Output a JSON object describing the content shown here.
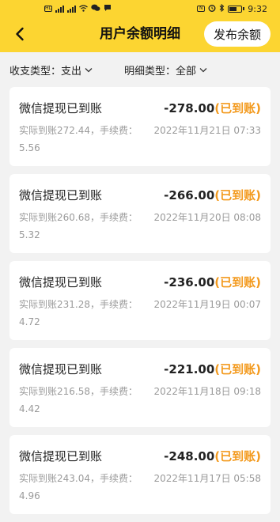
{
  "status_bar": {
    "time": "9:32",
    "left_indicators": [
      "HD",
      "4G",
      "4G",
      "wifi",
      "wechat",
      "message"
    ],
    "right_indicators": [
      "nfc",
      "alarm",
      "bluetooth",
      "battery"
    ]
  },
  "header": {
    "back_icon": "chevron-left-icon",
    "title": "用户余额明细",
    "publish_button": "发布余额",
    "background": "#fcd531"
  },
  "filters": {
    "income_expense": {
      "label": "收支类型：",
      "value": "支出"
    },
    "detail_type": {
      "label": "明细类型：",
      "value": "全部"
    }
  },
  "colors": {
    "status_accent": "#f39a1e",
    "muted_text": "#9a9a9a"
  },
  "records": [
    {
      "title": "微信提现已到账",
      "amount": "-278.00",
      "status": "(已到账)",
      "note": "实际到账272.44，手续费：5.56",
      "time": "2022年11月21日 07:33"
    },
    {
      "title": "微信提现已到账",
      "amount": "-266.00",
      "status": "(已到账)",
      "note": "实际到账260.68，手续费：5.32",
      "time": "2022年11月20日 08:08"
    },
    {
      "title": "微信提现已到账",
      "amount": "-236.00",
      "status": "(已到账)",
      "note": "实际到账231.28，手续费：4.72",
      "time": "2022年11月19日 00:07"
    },
    {
      "title": "微信提现已到账",
      "amount": "-221.00",
      "status": "(已到账)",
      "note": "实际到账216.58，手续费：4.42",
      "time": "2022年11月18日 09:18"
    },
    {
      "title": "微信提现已到账",
      "amount": "-248.00",
      "status": "(已到账)",
      "note": "实际到账243.04，手续费：4.96",
      "time": "2022年11月17日 05:58"
    }
  ]
}
